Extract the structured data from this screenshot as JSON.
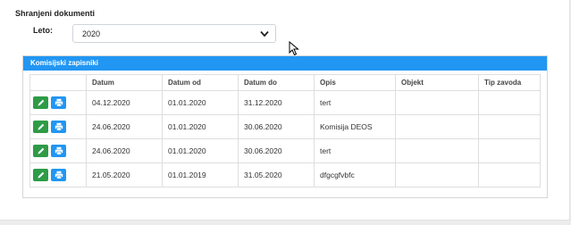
{
  "section": {
    "title": "Shranjeni dokumenti",
    "year_label": "Leto:",
    "year_value": "2020"
  },
  "card": {
    "title": "Komisijski zapisniki",
    "columns": [
      "",
      "Datum",
      "Datum od",
      "Datum do",
      "Opis",
      "Objekt",
      "Tip zavoda"
    ],
    "rows": [
      {
        "datum": "04.12.2020",
        "datum_od": "01.01.2020",
        "datum_do": "31.12.2020",
        "opis": "tert",
        "objekt": "",
        "tip_zavoda": ""
      },
      {
        "datum": "24.06.2020",
        "datum_od": "01.01.2020",
        "datum_do": "30.06.2020",
        "opis": "Komisija DEOS",
        "objekt": "",
        "tip_zavoda": ""
      },
      {
        "datum": "24.06.2020",
        "datum_od": "01.01.2020",
        "datum_do": "30.06.2020",
        "opis": "tert",
        "objekt": "",
        "tip_zavoda": ""
      },
      {
        "datum": "21.05.2020",
        "datum_od": "01.01.2019",
        "datum_do": "31.05.2020",
        "opis": "dfgcgfvbfc",
        "objekt": "",
        "tip_zavoda": ""
      }
    ]
  },
  "icons": {
    "edit": "pencil-icon",
    "print": "printer-icon",
    "dropdown": "chevron-down-icon"
  },
  "colors": {
    "header_blue": "#2196f3",
    "edit_green": "#2e9b47",
    "print_blue": "#2196f3"
  }
}
